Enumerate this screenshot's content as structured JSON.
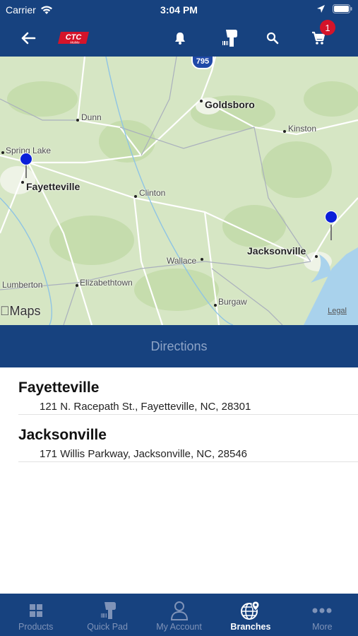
{
  "status_bar": {
    "carrier": "Carrier",
    "time": "3:04 PM"
  },
  "nav_bar": {
    "logo_text": "CTC",
    "logo_sub": "Mobile",
    "cart_badge": "1"
  },
  "map": {
    "shield": "795",
    "cities": [
      {
        "name": "Goldsboro"
      },
      {
        "name": "Dunn"
      },
      {
        "name": "Kinston"
      },
      {
        "name": "Spring Lake"
      },
      {
        "name": "Fayetteville"
      },
      {
        "name": "Clinton"
      },
      {
        "name": "Jacksonville"
      },
      {
        "name": "Wallace"
      },
      {
        "name": "Lumberton"
      },
      {
        "name": "Elizabethtown"
      },
      {
        "name": "Burgaw"
      }
    ],
    "logo": "Maps",
    "legal": "Legal"
  },
  "directions_label": "Directions",
  "branches": [
    {
      "name": "Fayetteville",
      "address": "121 N. Racepath St., Fayetteville, NC, 28301"
    },
    {
      "name": "Jacksonville",
      "address": "171 Willis Parkway, Jacksonville, NC, 28546"
    }
  ],
  "tabs": [
    {
      "label": "Products",
      "icon": "grid-icon"
    },
    {
      "label": "Quick Pad",
      "icon": "scanner-icon"
    },
    {
      "label": "My Account",
      "icon": "person-icon"
    },
    {
      "label": "Branches",
      "icon": "globe-pin-icon",
      "active": true
    },
    {
      "label": "More",
      "icon": "more-icon"
    }
  ],
  "colors": {
    "brand": "#17427f",
    "badge": "#d4142a",
    "pin": "#0a1fd9",
    "map_land": "#d9e8c8",
    "water": "#a9d2ec"
  }
}
